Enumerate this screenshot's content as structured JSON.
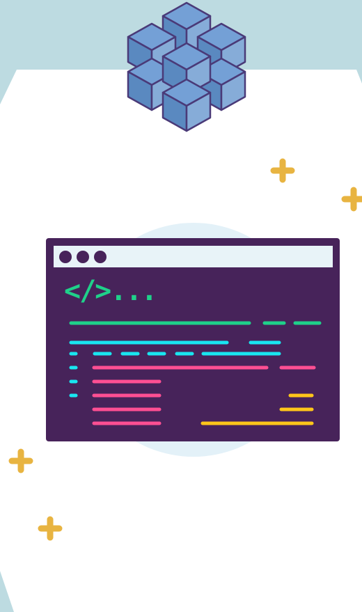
{
  "editor": {
    "code_tag": "</>..."
  },
  "colors": {
    "sky": "#bddbe1",
    "panel": "#ffffff",
    "glow": "#e3f1f8",
    "window_body": "#47235a",
    "title_bar": "#e8f3f8",
    "code_green": "#1fd18a",
    "code_cyan": "#19e6f0",
    "code_pink": "#ff4f93",
    "code_yellow": "#ffc61a",
    "sparkle": "#e8b441",
    "cube_face_front": "#5a89c0",
    "cube_face_side": "#86acd8",
    "cube_face_top": "#74a0d6",
    "cube_outline": "#4a3a78"
  },
  "icons": [
    "cube-cluster-icon",
    "sparkle-plus-icon",
    "window-dot-icon"
  ]
}
